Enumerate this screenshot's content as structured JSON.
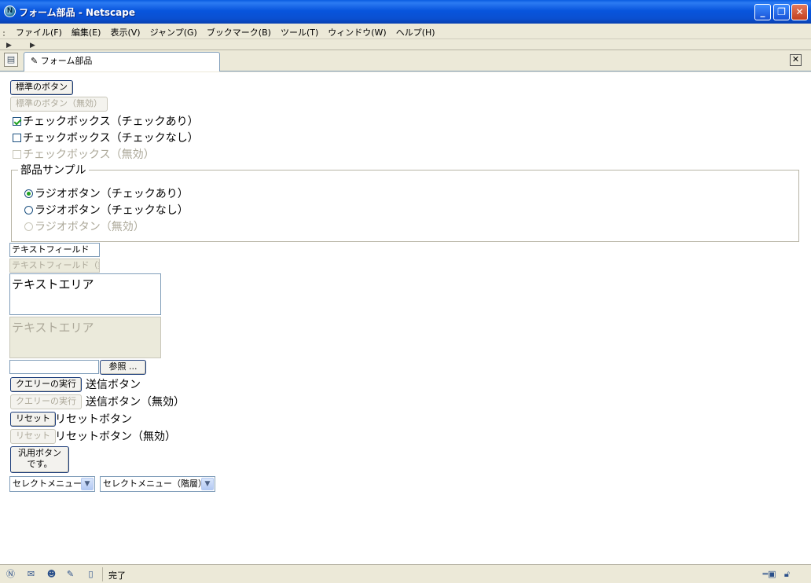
{
  "window": {
    "title": "フォーム部品 - Netscape",
    "logo_glyph": "N",
    "minimize_glyph": "_",
    "restore_glyph": "❐",
    "close_glyph": "✕"
  },
  "menu": [
    "ファイル(F)",
    "編集(E)",
    "表示(V)",
    "ジャンプ(G)",
    "ブックマーク(B)",
    "ツール(T)",
    "ウィンドウ(W)",
    "ヘルプ(H)"
  ],
  "tab": {
    "label": "フォーム部品",
    "close_glyph": "✕"
  },
  "form": {
    "standard_button": "標準のボタン",
    "standard_button_disabled": "標準のボタン（無効）",
    "checkbox_checked": "チェックボックス（チェックあり）",
    "checkbox_unchecked": "チェックボックス（チェックなし）",
    "checkbox_disabled": "チェックボックス（無効）",
    "fieldset_legend": "部品サンプル",
    "radio_checked": "ラジオボタン（チェックあり）",
    "radio_unchecked": "ラジオボタン（チェックなし）",
    "radio_disabled": "ラジオボタン（無効）",
    "textfield_value": "テキストフィールド",
    "textfield_disabled_value": "テキストフィールド（無効）",
    "textarea_value": "テキストエリア",
    "textarea_disabled_value": "テキストエリア",
    "browse_button": "参照 ...",
    "submit_button": "クエリーの実行",
    "submit_label": "送信ボタン",
    "submit_disabled_label": "送信ボタン（無効）",
    "reset_button": "リセット",
    "reset_label": "リセットボタン",
    "reset_disabled_label": "リセットボタン（無効）",
    "generic_button_line1": "汎用ボタン",
    "generic_button_line2": "です。",
    "select_menu": "セレクトメニュー",
    "select_menu_tree": "セレクトメニュー（階層）"
  },
  "status": {
    "text": "完了"
  }
}
